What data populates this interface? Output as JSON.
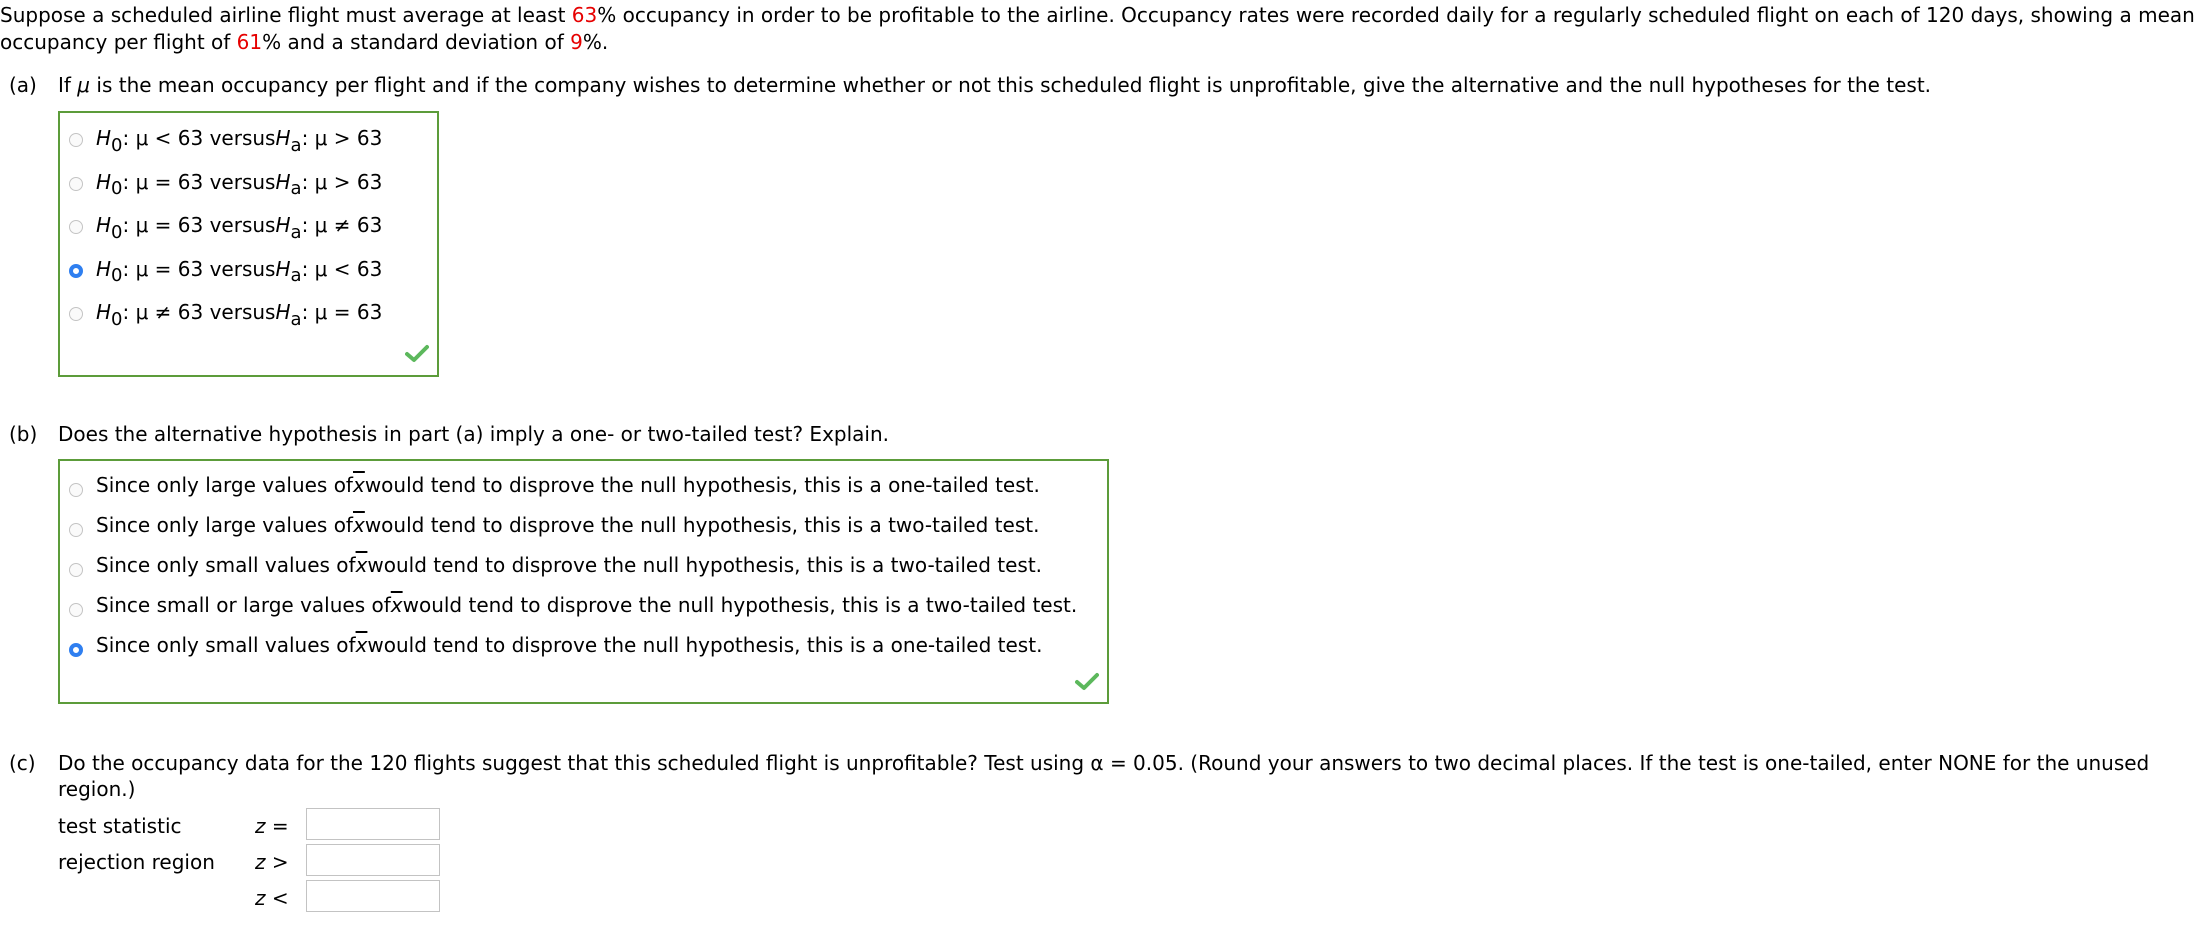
{
  "intro": {
    "part1": "Suppose a scheduled airline flight must average at least ",
    "min_occupancy": "63",
    "part2": "% occupancy in order to be profitable to the airline. Occupancy rates were recorded daily for a regularly scheduled flight on each of 120 days, showing a mean occupancy per flight of ",
    "mean_occupancy": "61",
    "part3": "% and a standard deviation of ",
    "std_dev": "9",
    "part4": "%."
  },
  "part_a": {
    "label": "(a)",
    "question_prefix": "If ",
    "mu": "μ",
    "question_suffix": " is the mean occupancy per flight and if the company wishes to determine whether or not this scheduled flight is unprofitable, give the alternative and the null hypotheses for the test.",
    "options": [
      {
        "h0": ": μ < 63 versus ",
        "ha": ": μ > 63",
        "selected": false
      },
      {
        "h0": ": μ = 63 versus ",
        "ha": ": μ > 63",
        "selected": false
      },
      {
        "h0": ": μ = 63 versus ",
        "ha": ": μ ≠ 63",
        "selected": false
      },
      {
        "h0": ": μ = 63 versus ",
        "ha": ": μ < 63",
        "selected": true
      },
      {
        "h0": ": μ ≠ 63 versus ",
        "ha": ": μ = 63",
        "selected": false
      }
    ],
    "h_symbol": "H",
    "h0_sub": "0",
    "ha_sub": "a",
    "status": "correct",
    "check_color": "#5cb85c"
  },
  "part_b": {
    "label": "(b)",
    "question": "Does the alternative hypothesis in part (a) imply a one- or two-tailed test? Explain.",
    "xbar": "x",
    "options": [
      {
        "pre": "Since only large values of ",
        "post": " would tend to disprove the null hypothesis, this is a one-tailed test.",
        "selected": false
      },
      {
        "pre": "Since only large values of ",
        "post": " would tend to disprove the null hypothesis, this is a two-tailed test.",
        "selected": false
      },
      {
        "pre": "Since only small values of ",
        "post": " would tend to disprove the null hypothesis, this is a two-tailed test.",
        "selected": false
      },
      {
        "pre": "Since small or large values of ",
        "post": " would tend to disprove the null hypothesis, this is a two-tailed test.",
        "selected": false
      },
      {
        "pre": "Since only small values of ",
        "post": " would tend to disprove the null hypothesis, this is a one-tailed test.",
        "selected": true
      }
    ],
    "status": "correct"
  },
  "part_c": {
    "label": "(c)",
    "question_line1": "Do the occupancy data for the 120 flights suggest that this scheduled flight is unprofitable? Test using α = 0.05. (Round your answers to two decimal places. If the test is one-tailed, enter NONE for the unused",
    "question_line2": "region.)",
    "test_statistic_label": "test statistic",
    "rejection_region_label": "rejection region",
    "z": "z",
    "eq": "=",
    "gt": ">",
    "lt": "<",
    "test_statistic_value": "",
    "rejection_upper_value": "",
    "rejection_lower_value": ""
  }
}
